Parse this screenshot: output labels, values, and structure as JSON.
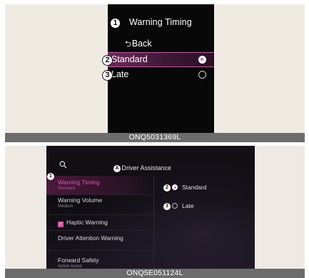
{
  "top_panel": {
    "title": "Warning Timing",
    "back_label": "Back",
    "options": [
      {
        "label": "Standard",
        "selected": true
      },
      {
        "label": "Late",
        "selected": false
      }
    ],
    "callouts": [
      "1",
      "2",
      "3"
    ],
    "image_code": "ONQ5031369L"
  },
  "bottom_panel": {
    "header": {
      "title": "Driver Assistance",
      "callout": "A",
      "search_icon": "search-icon"
    },
    "menu_items": [
      {
        "label": "Warning Timing",
        "value": "Standard",
        "selected": true
      },
      {
        "label": "Warning Volume",
        "value": "Medium"
      },
      {
        "label": "Haptic Warning",
        "checked": true
      },
      {
        "label": "Driver Attention Warning"
      },
      {
        "label": "Forward Safety",
        "value": "Active Assist"
      }
    ],
    "options": [
      {
        "label": "Standard",
        "selected": true
      },
      {
        "label": "Late",
        "selected": false
      }
    ],
    "callouts": [
      "1",
      "2",
      "3"
    ],
    "image_code": "ONQ5E051124L"
  },
  "colors": {
    "accent_pink": "#e25aa6",
    "selection_bar": "#6e2a5c",
    "caption_bar": "#6c6c6c",
    "panel_background": "#efebe3",
    "screen_background": "#080808"
  }
}
